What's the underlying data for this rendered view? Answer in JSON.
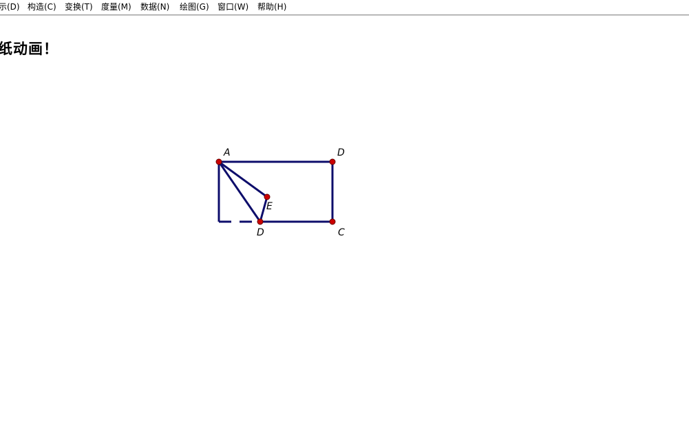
{
  "menu": {
    "items": [
      {
        "label": "示(D)"
      },
      {
        "label": "构造(C)"
      },
      {
        "label": "变换(T)"
      },
      {
        "label": "度量(M)"
      },
      {
        "label": "数据(N)"
      },
      {
        "label": "绘图(G)"
      },
      {
        "label": "窗口(W)"
      },
      {
        "label": "帮助(H)"
      }
    ]
  },
  "canvas": {
    "title": "纸动画！"
  },
  "figure": {
    "line_color": "#0d0d6b",
    "point_color": "#cc0000",
    "points": {
      "A": "A",
      "D_top": "D",
      "E": "E",
      "D_bottom": "D",
      "C": "C"
    }
  }
}
